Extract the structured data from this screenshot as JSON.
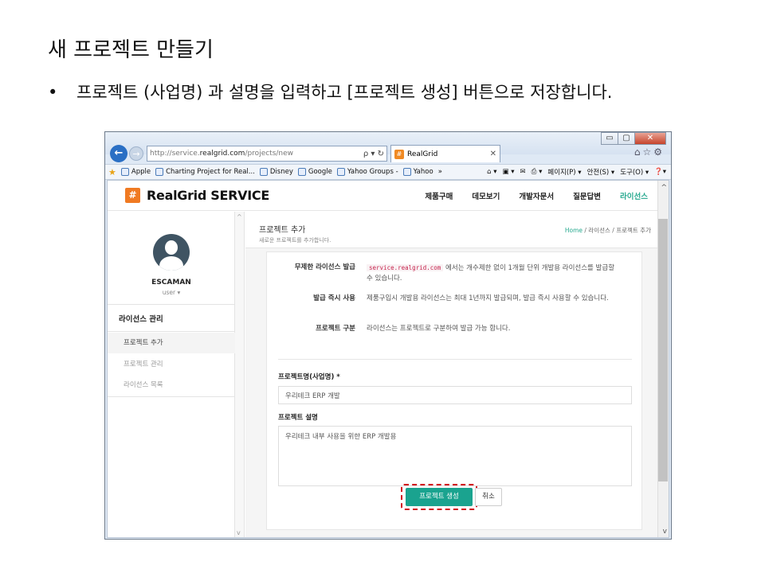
{
  "slide": {
    "title": "새 프로젝트 만들기",
    "bullet_marker": "•",
    "bullet_text": "프로젝트 (사업명) 과 설명을 입력하고 [프로젝트 생성] 버튼으로 저장합니다."
  },
  "browser": {
    "url_prefix": "http://service.",
    "url_domain": "realgrid.com",
    "url_path": "/projects/new",
    "addr_tools": "ρ ▾ ↻",
    "tab_title": "RealGrid",
    "tab_close": "✕",
    "win_minimize": "▭",
    "win_restore": "▢",
    "win_close": "✕",
    "back": "←",
    "forward": "→",
    "right_icons": "⌂☆⚙",
    "favorites": [
      "Apple",
      "Charting Project for Real...",
      "Disney",
      "Google",
      "Yahoo Groups -",
      "Yahoo"
    ],
    "more": "»",
    "commands": [
      "⌂ ▾",
      "▣ ▾",
      "✉",
      "⎙ ▾",
      "페이지(P) ▾",
      "안전(S) ▾",
      "도구(O) ▾",
      "❓▾"
    ]
  },
  "site": {
    "logo_mark": "#",
    "logo_text": "RealGrid SERVICE",
    "nav": [
      "제품구매",
      "데모보기",
      "개발자문서",
      "질문답변",
      "라이선스"
    ]
  },
  "sidebar": {
    "username": "ESCAMAN",
    "role": "user ▾",
    "section": "라이선스 관리",
    "items": [
      "프로젝트 추가",
      "프로젝트 관리",
      "라이선스 목록"
    ]
  },
  "content": {
    "title": "프로젝트 추가",
    "subtitle": "새로운 프로젝트를 추가합니다.",
    "breadcrumb_home": "Home",
    "breadcrumb_rest": " / 라이선스 / 프로젝트 추가",
    "info": [
      {
        "label": "무제한 라이선스 발급",
        "code": "service.realgrid.com",
        "text": " 에서는 개수제한 없이 1개월 단위 개발용 라이선스를 발급할 수 있습니다."
      },
      {
        "label": "발급 즉시 사용",
        "text": "제품구입시 개발용 라이선스는 최대 1년까지 발급되며, 발급 즉시 사용할 수 있습니다."
      },
      {
        "label": "프로젝트 구분",
        "text": "라이선스는 프로젝트로 구분하여 발급 가능 합니다."
      }
    ],
    "name_label": "프로젝트명(사업명) *",
    "name_value": "우리테크 ERP 개발",
    "desc_label": "프로젝트 설명",
    "desc_value": "우리테크 내부 사용을 위한 ERP 개발용",
    "submit": "프로젝트 생성",
    "cancel": "취소"
  },
  "colors": {
    "accent": "#1aa38f",
    "logo": "#f07a22",
    "highlight": "#d1111b"
  }
}
